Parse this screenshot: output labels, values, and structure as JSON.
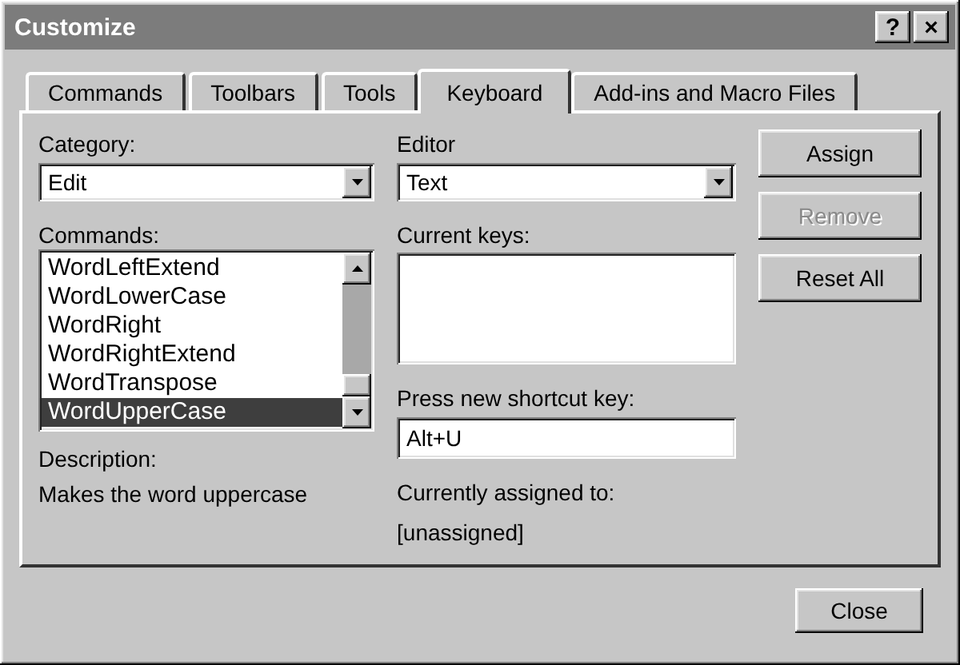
{
  "window": {
    "title": "Customize"
  },
  "title_buttons": [
    {
      "label": "?"
    },
    {
      "label": "×"
    }
  ],
  "tabs": [
    {
      "label": "Commands",
      "selected": false
    },
    {
      "label": "Toolbars",
      "selected": false
    },
    {
      "label": "Tools",
      "selected": false
    },
    {
      "label": "Keyboard",
      "selected": true
    },
    {
      "label": "Add-ins and Macro Files",
      "selected": false
    }
  ],
  "category": {
    "label": "Category:",
    "value": "Edit"
  },
  "commands": {
    "label": "Commands:",
    "items": [
      {
        "label": "WordLeftExtend",
        "selected": false
      },
      {
        "label": "WordLowerCase",
        "selected": false
      },
      {
        "label": "WordRight",
        "selected": false
      },
      {
        "label": "WordRightExtend",
        "selected": false
      },
      {
        "label": "WordTranspose",
        "selected": false
      },
      {
        "label": "WordUpperCase",
        "selected": true
      }
    ]
  },
  "description": {
    "label": "Description:",
    "text": "Makes the word uppercase"
  },
  "editor": {
    "label": "Editor",
    "value": "Text"
  },
  "current_keys": {
    "label": "Current keys:"
  },
  "shortcut": {
    "label": "Press new shortcut key:",
    "value": "Alt+U"
  },
  "assigned": {
    "label": "Currently assigned to:",
    "value": "[unassigned]"
  },
  "buttons": [
    {
      "label": "Assign",
      "disabled": false
    },
    {
      "label": "Remove",
      "disabled": true
    },
    {
      "label": "Reset All",
      "disabled": false
    }
  ],
  "close_button": {
    "label": "Close"
  }
}
